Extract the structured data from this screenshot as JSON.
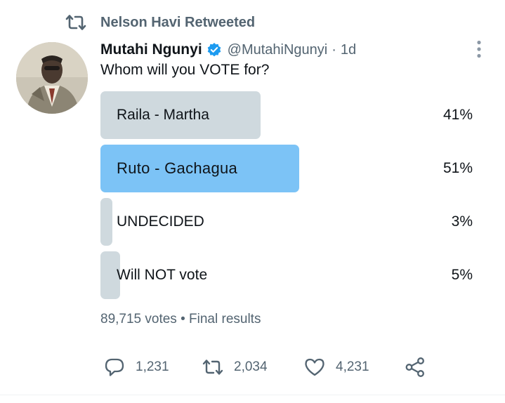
{
  "retweet_banner": {
    "text": "Nelson Havi Retweeted"
  },
  "tweet": {
    "author_name": "Mutahi Ngunyi",
    "author_handle": "@MutahiNgunyi",
    "separator": "·",
    "time_ago": "1d",
    "text": "Whom will you VOTE for?"
  },
  "poll": {
    "options": [
      {
        "label": "Raila - Martha",
        "percent_text": "41%",
        "percent": 41,
        "winner": false
      },
      {
        "label": "Ruto - Gachagua",
        "percent_text": "51%",
        "percent": 51,
        "winner": true
      },
      {
        "label": "UNDECIDED",
        "percent_text": "3%",
        "percent": 3,
        "winner": false
      },
      {
        "label": "Will NOT vote",
        "percent_text": "5%",
        "percent": 5,
        "winner": false
      }
    ],
    "votes": "89,715 votes",
    "bullet": "•",
    "status": "Final results"
  },
  "actions": {
    "replies": "1,231",
    "retweets": "2,034",
    "likes": "4,231"
  },
  "colors": {
    "winner_bar": "#7cc3f6",
    "other_bar": "#cfd9de",
    "verified": "#1d9bf0",
    "secondary_text": "#536471"
  }
}
